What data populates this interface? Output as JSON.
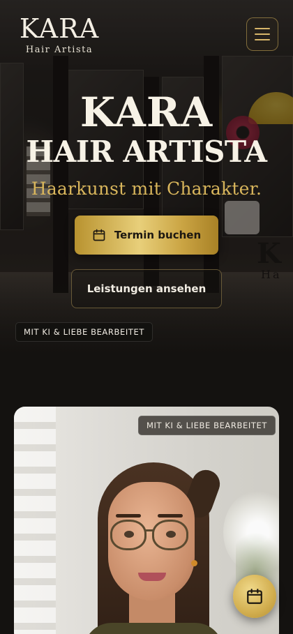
{
  "header": {
    "logo_title": "KARA",
    "logo_subtitle": "Hair Artista",
    "menu_icon": "hamburger-icon"
  },
  "hero": {
    "title_line1": "KARA",
    "title_line2": "HAIR ARTISTA",
    "tagline": "Haarkunst mit Charakter.",
    "primary_button": {
      "label": "Termin buchen",
      "icon": "calendar-icon"
    },
    "secondary_button": {
      "label": "Leistungen ansehen"
    },
    "badge": "MIT KI & LIEBE BEARBEITET"
  },
  "portrait_card": {
    "badge": "MIT KI & LIEBE BEARBEITET"
  },
  "floating_button": {
    "icon": "calendar-icon"
  },
  "colors": {
    "gold": "#d9b65c",
    "background": "#141210",
    "title": "#f7f2e6"
  }
}
